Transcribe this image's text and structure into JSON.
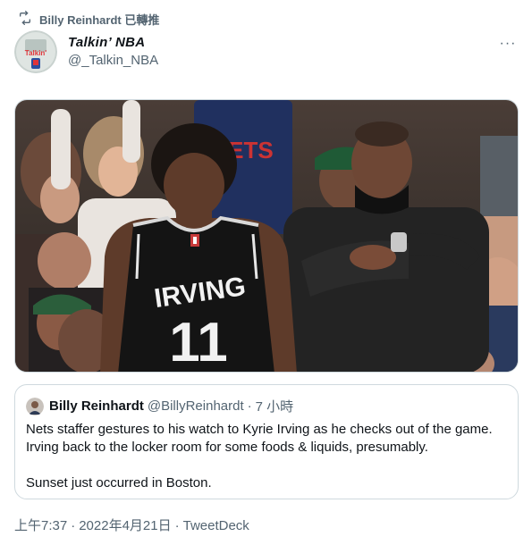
{
  "retweet": {
    "label": "Billy Reinhardt 已轉推"
  },
  "author": {
    "name": "Talkin’ NBA",
    "handle": "@_Talkin_NBA",
    "avatar_text": "Talkin'"
  },
  "more": {
    "label": "···"
  },
  "media": {
    "jersey_name": "IRVING",
    "jersey_number": "11",
    "background_jersey_text": "NETS"
  },
  "quote": {
    "name": "Billy Reinhardt",
    "handle": "@BillyReinhardt",
    "separator": "·",
    "time": "7 小時",
    "line1": "Nets staffer gestures to his watch to Kyrie Irving as he checks out of the game.",
    "line2": "Irving back to the locker room for some foods & liquids, presumably.",
    "line3": "Sunset just occurred in Boston."
  },
  "meta": {
    "time": "上午7:37",
    "date": "2022年4月21日",
    "separator": "·",
    "client": "TweetDeck"
  },
  "colors": {
    "text": "#0f1419",
    "secondary": "#536471",
    "border": "#cfd9de"
  }
}
